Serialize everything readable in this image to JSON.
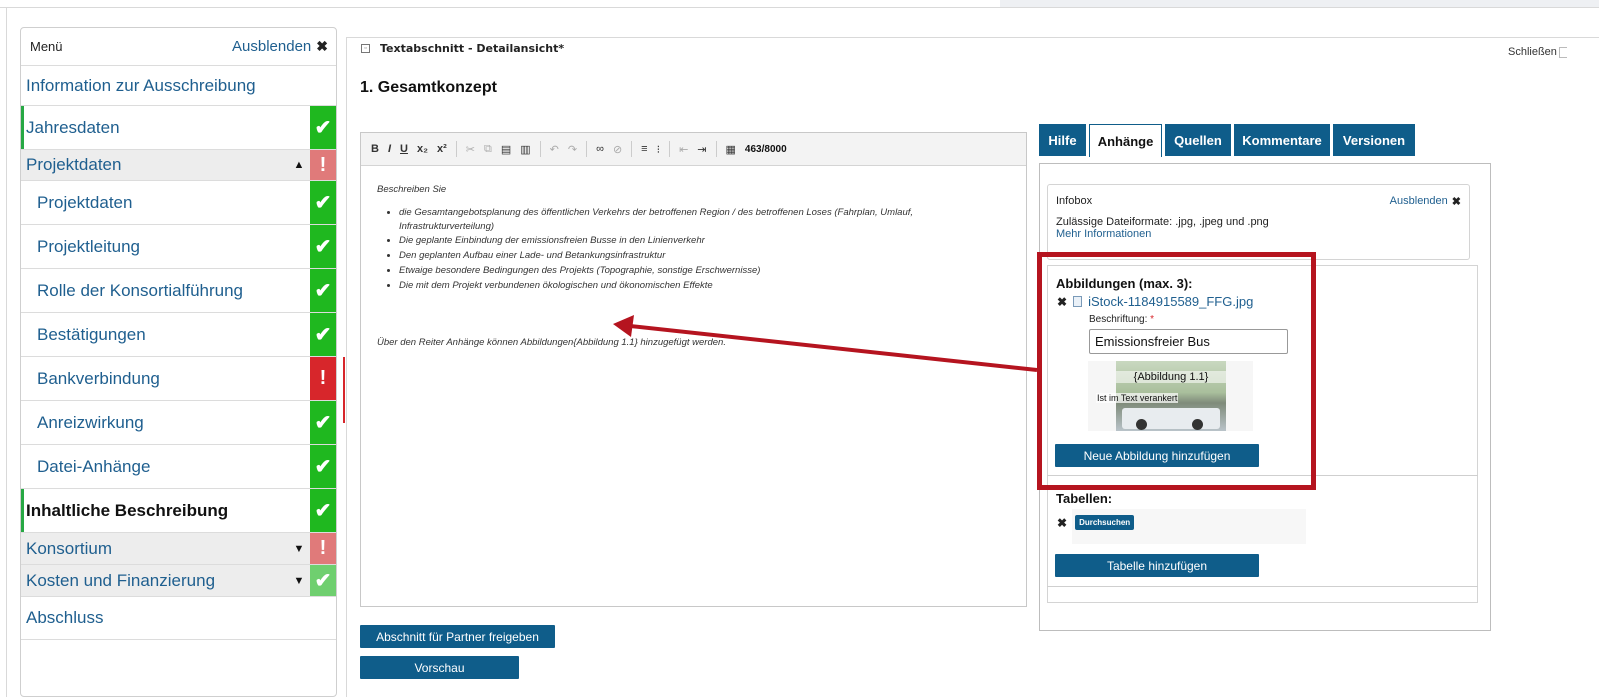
{
  "sidebar": {
    "title": "Menü",
    "hide_label": "Ausblenden",
    "hide_icon": "close-icon",
    "items": [
      {
        "label": "Information zur Ausschreibung",
        "status": "none"
      },
      {
        "label": "Jahresdaten",
        "status": "ok"
      },
      {
        "label": "Projektdaten",
        "status": "error",
        "expanded": true
      },
      {
        "label": "Projektdaten",
        "status": "ok"
      },
      {
        "label": "Projektleitung",
        "status": "ok"
      },
      {
        "label": "Rolle der Konsortialführung",
        "status": "ok"
      },
      {
        "label": "Bestätigungen",
        "status": "ok"
      },
      {
        "label": "Bankverbindung",
        "status": "error"
      },
      {
        "label": "Anreizwirkung",
        "status": "ok"
      },
      {
        "label": "Datei-Anhänge",
        "status": "ok"
      },
      {
        "label": "Inhaltliche Beschreibung",
        "status": "ok",
        "active": true
      },
      {
        "label": "Konsortium",
        "status": "error",
        "expanded": false
      },
      {
        "label": "Kosten und Finanzierung",
        "status": "ok",
        "expanded": false
      },
      {
        "label": "Abschluss",
        "status": "none"
      }
    ]
  },
  "main": {
    "window_title": "Textabschnitt - Detailansicht*",
    "close_label": "Schließen",
    "section_title": "1. Gesamtkonzept",
    "toolbar": {
      "bold": "B",
      "italic": "I",
      "underline": "U",
      "subscript": "x₂",
      "superscript": "x²",
      "char_count": "463/8000"
    },
    "editor": {
      "intro": "Beschreiben Sie",
      "bullets": [
        "die Gesamtangebotsplanung des öffentlichen Verkehrs der betroffenen Region / des betroffenen Loses (Fahrplan, Umlauf, Infrastrukturverteilung)",
        "Die geplante Einbindung der emissionsfreien Busse in den Linienverkehr",
        "Den geplanten Aufbau einer Lade- und Betankungsinfrastruktur",
        "Etwaige besondere Bedingungen des Projekts (Topographie, sonstige Erschwernisse)",
        "Die mit dem Projekt verbundenen ökologischen und ökonomischen Effekte"
      ],
      "footer": "Über den Reiter Anhänge können Abbildungen{Abbildung 1.1} hinzugefügt werden."
    },
    "release_button": "Abschnitt für Partner freigeben",
    "preview_button": "Vorschau"
  },
  "right_panel": {
    "tabs": [
      {
        "label": "Hilfe",
        "active": false
      },
      {
        "label": "Anhänge",
        "active": true
      },
      {
        "label": "Quellen",
        "active": false
      },
      {
        "label": "Kommentare",
        "active": false
      },
      {
        "label": "Versionen",
        "active": false
      }
    ],
    "infobox": {
      "title": "Infobox",
      "hide_label": "Ausblenden",
      "formats_text": "Zulässige Dateiformate: .jpg, .jpeg und .png",
      "more_link": "Mehr Informationen"
    },
    "images": {
      "title": "Abbildungen (max. 3):",
      "file_name": "iStock-1184915589_FFG.jpg",
      "caption_label": "Beschriftung:",
      "required_mark": "*",
      "caption_value": "Emissionsfreier Bus",
      "thumb_ref": "{Abbildung 1.1}",
      "thumb_note": "Ist im Text verankert",
      "add_button": "Neue Abbildung hinzufügen"
    },
    "tables": {
      "title": "Tabellen:",
      "browse_button": "Durchsuchen",
      "add_button": "Tabelle hinzufügen"
    }
  },
  "colors": {
    "primary": "#0f5d8a",
    "ok": "#1fb81f",
    "error": "#d7262b",
    "highlight": "#b5141f",
    "link": "#1f5f8f"
  }
}
